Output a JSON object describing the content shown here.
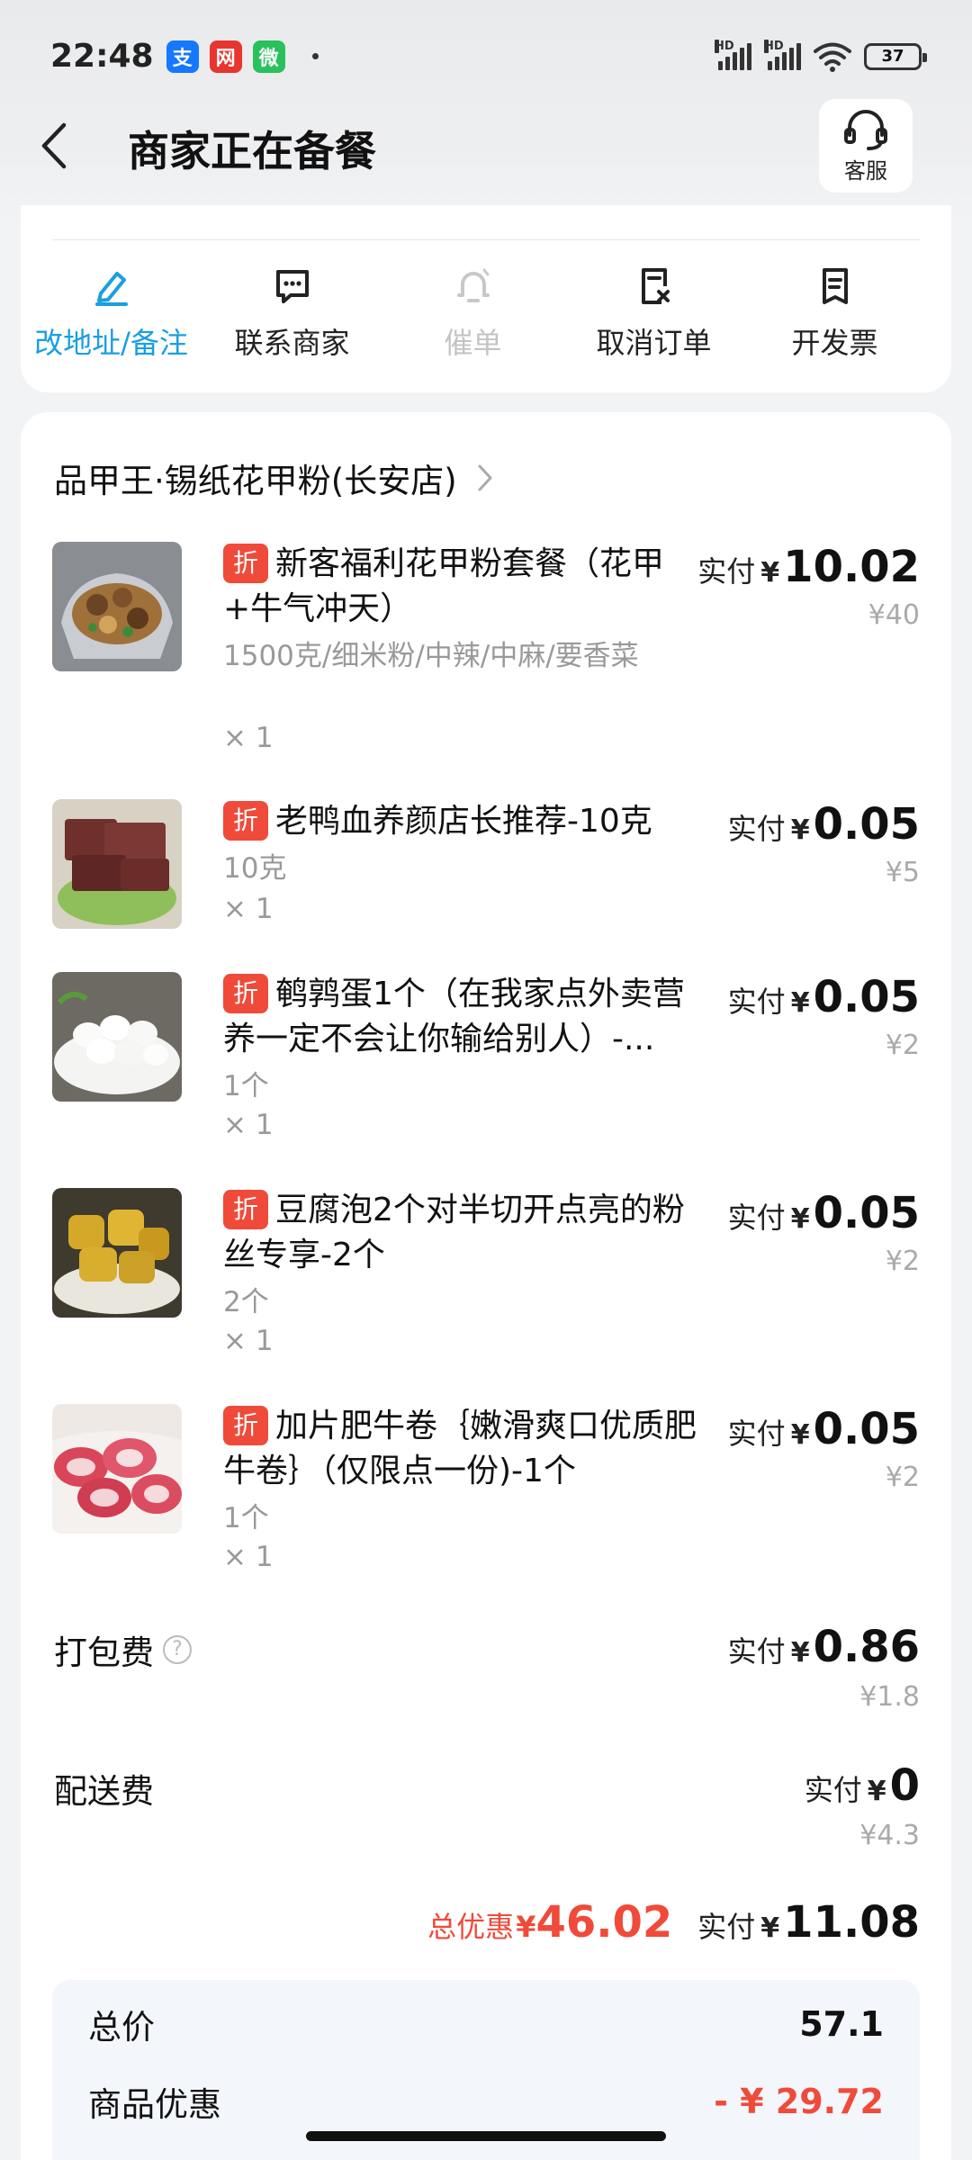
{
  "status_bar": {
    "time": "22:48",
    "apps": [
      {
        "name": "alipay",
        "glyph": "支",
        "color": "#1677ff"
      },
      {
        "name": "news",
        "glyph": "网",
        "color": "#e8352e"
      },
      {
        "name": "wechat",
        "glyph": "微",
        "color": "#2ac05c"
      }
    ],
    "network": "HD",
    "battery": "37"
  },
  "header": {
    "title": "商家正在备餐",
    "service_label": "客服"
  },
  "actions": [
    {
      "label": "改地址/备注",
      "state": "active",
      "icon": "edit-icon"
    },
    {
      "label": "联系商家",
      "state": "normal",
      "icon": "chat-icon"
    },
    {
      "label": "催单",
      "state": "disabled",
      "icon": "bell-icon"
    },
    {
      "label": "取消订单",
      "state": "normal",
      "icon": "cancel-order-icon"
    },
    {
      "label": "开发票",
      "state": "normal",
      "icon": "invoice-icon"
    }
  ],
  "shop": {
    "name": "品甲王·锡纸花甲粉(长安店)"
  },
  "labels": {
    "discount_tag": "折",
    "paid": "实付",
    "yen": "¥",
    "total_discount": "总优惠"
  },
  "items": [
    {
      "title": "新客福利花甲粉套餐（花甲+牛气冲天）",
      "spec": "1500克/细米粉/中辣/中麻/要香菜",
      "qty": "× 1",
      "paid": "10.02",
      "original": "¥40"
    },
    {
      "title": "老鸭血养颜店长推荐-10克",
      "spec": "10克",
      "qty": "× 1",
      "paid": "0.05",
      "original": "¥5"
    },
    {
      "title": "鹌鹑蛋1个（在我家点外卖营养一定不会让你输给别人）-...",
      "spec": "1个",
      "qty": "× 1",
      "paid": "0.05",
      "original": "¥2"
    },
    {
      "title": "豆腐泡2个对半切开点亮的粉丝专享-2个",
      "spec": "2个",
      "qty": "× 1",
      "paid": "0.05",
      "original": "¥2"
    },
    {
      "title": "加片肥牛卷｛嫩滑爽口优质肥牛卷｝（仅限点一份)-1个",
      "spec": "1个",
      "qty": "× 1",
      "paid": "0.05",
      "original": "¥2"
    }
  ],
  "fees": {
    "packing": {
      "label": "打包费",
      "paid": "0.86",
      "original": "¥1.8"
    },
    "delivery": {
      "label": "配送费",
      "paid": "0",
      "original": "¥4.3"
    }
  },
  "totals": {
    "discount": "46.02",
    "paid": "11.08"
  },
  "summary": {
    "total_price_label": "总价",
    "total_price": "57.1",
    "goods_discount_label": "商品优惠",
    "goods_discount": "- ¥ 29.72"
  }
}
